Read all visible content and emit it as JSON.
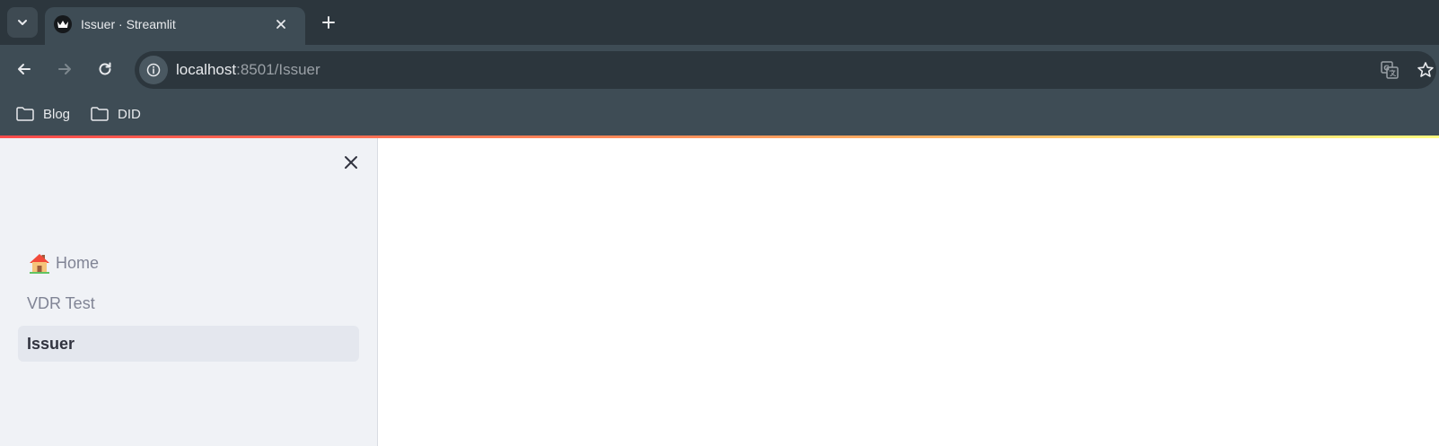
{
  "browser": {
    "tab": {
      "title": "Issuer · Streamlit",
      "favicon": "streamlit-crown-icon"
    },
    "toolbar": {
      "url_host": "localhost",
      "url_rest": ":8501/Issuer"
    },
    "bookmarks": [
      {
        "label": "Blog",
        "icon": "folder-icon"
      },
      {
        "label": "DID",
        "icon": "folder-icon"
      }
    ]
  },
  "app": {
    "colors": {
      "sidebar_bg": "#f0f2f6",
      "active_item_bg": "#e4e7ee",
      "active_text": "#31333f",
      "inactive_text": "#808495",
      "decoration_start": "#ff4b4b",
      "decoration_end": "#fffd80"
    },
    "sidebar": {
      "nav_items": [
        {
          "label": "Home",
          "icon": "house-emoji",
          "active": false
        },
        {
          "label": "VDR Test",
          "active": false
        },
        {
          "label": "Issuer",
          "active": true
        }
      ]
    }
  }
}
